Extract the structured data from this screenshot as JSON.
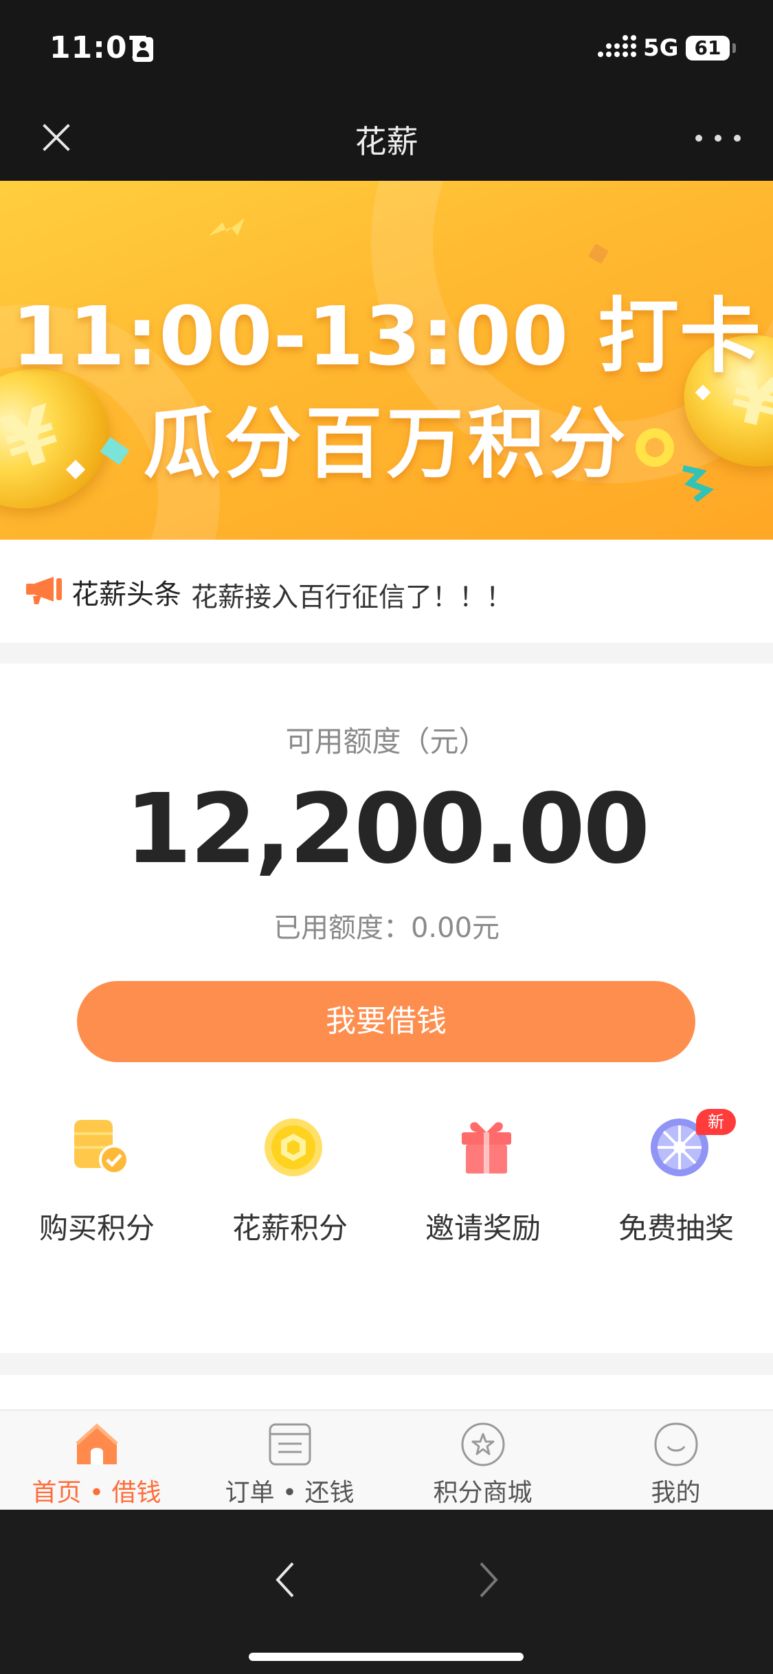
{
  "status_bar": {
    "time": "11:07",
    "network": "5G",
    "battery": "61"
  },
  "nav": {
    "title": "花薪"
  },
  "banner": {
    "line1": "11:00-13:00 打卡",
    "line2": "瓜分百万积分",
    "coin_symbol": "¥"
  },
  "news": {
    "label": "花薪头条",
    "text": "花薪接入百行征信了！！！"
  },
  "credit": {
    "available_label": "可用额度（元）",
    "available_amount": "12,200.00",
    "used_label": "已用额度：0.00元"
  },
  "actions": {
    "borrow_label": "我要借钱"
  },
  "features": [
    {
      "label": "购买积分",
      "icon": "buy-points-icon"
    },
    {
      "label": "花薪积分",
      "icon": "points-coin-icon"
    },
    {
      "label": "邀请奖励",
      "icon": "gift-icon"
    },
    {
      "label": "免费抽奖",
      "icon": "lottery-wheel-icon",
      "badge": "新"
    }
  ],
  "tabs": [
    {
      "label": "首页 • 借钱",
      "icon": "home-icon",
      "active": true
    },
    {
      "label": "订单 • 还钱",
      "icon": "order-list-icon",
      "active": false
    },
    {
      "label": "积分商城",
      "icon": "star-mall-icon",
      "active": false
    },
    {
      "label": "我的",
      "icon": "profile-smile-icon",
      "active": false
    }
  ],
  "colors": {
    "accent": "#fe8e4e",
    "tab_active": "#fe6c3a",
    "banner_orange": "#ffb830",
    "badge_red": "#ff3b3b"
  }
}
